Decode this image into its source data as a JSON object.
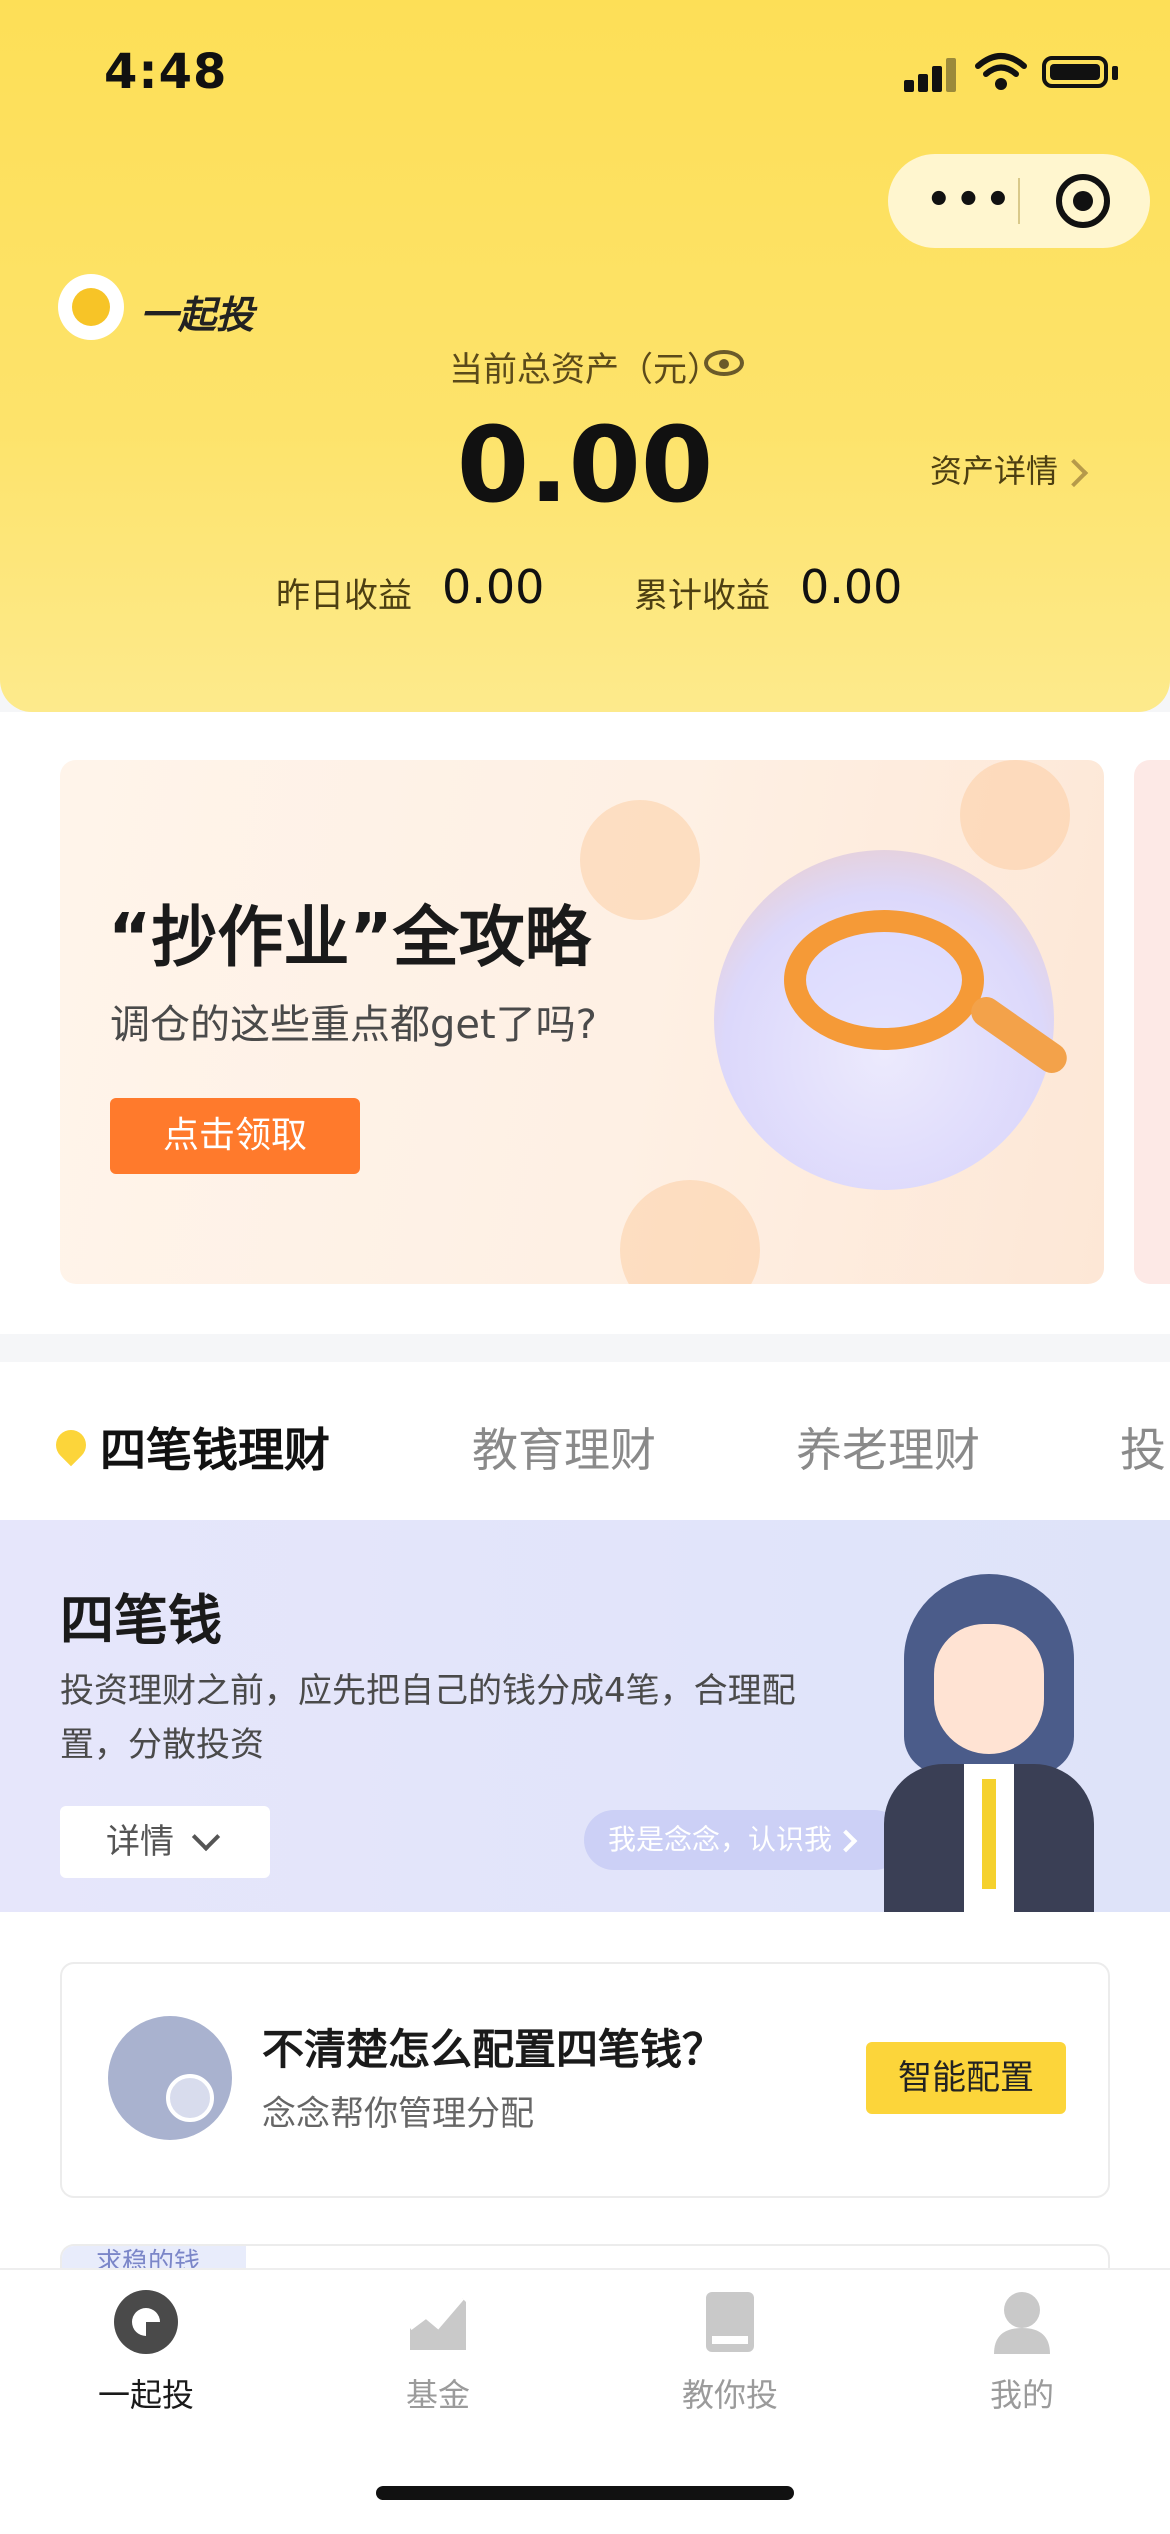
{
  "status_bar": {
    "time": "4:48"
  },
  "mini_program": {
    "more": "•••"
  },
  "brand": {
    "name": "一起投"
  },
  "assets": {
    "label": "当前总资产（元）",
    "total": "0.00",
    "detail_link": "资产详情",
    "yesterday_label": "昨日收益",
    "yesterday_value": "0.00",
    "cumulative_label": "累计收益",
    "cumulative_value": "0.00"
  },
  "banner": {
    "title": "“抄作业”全攻略",
    "subtitle": "调仓的这些重点都get了吗?",
    "button": "点击领取"
  },
  "tabs": [
    {
      "label": "四笔钱理财",
      "active": true
    },
    {
      "label": "教育理财",
      "active": false
    },
    {
      "label": "养老理财",
      "active": false
    },
    {
      "label": "投",
      "active": false
    }
  ],
  "intro": {
    "title": "四笔钱",
    "description": "投资理财之前，应先把自己的钱分成4笔，合理配置，分散投资",
    "detail_button": "详情",
    "meet_link": "我是念念，认识我"
  },
  "config_card": {
    "title": "不清楚怎么配置四笔钱？",
    "subtitle": "念念帮你管理分配",
    "button": "智能配置"
  },
  "next_card": {
    "tag": "求稳的钱"
  },
  "bottom_nav": [
    {
      "label": "一起投",
      "icon": "yiqitou-icon",
      "active": true
    },
    {
      "label": "基金",
      "icon": "fund-chart-icon",
      "active": false
    },
    {
      "label": "教你投",
      "icon": "book-icon",
      "active": false
    },
    {
      "label": "我的",
      "icon": "user-icon",
      "active": false
    }
  ],
  "colors": {
    "header_yellow": "#fddf57",
    "accent_orange": "#ff7a2c",
    "config_yellow": "#fcd53a",
    "intro_bg": "#e6e6fb"
  }
}
